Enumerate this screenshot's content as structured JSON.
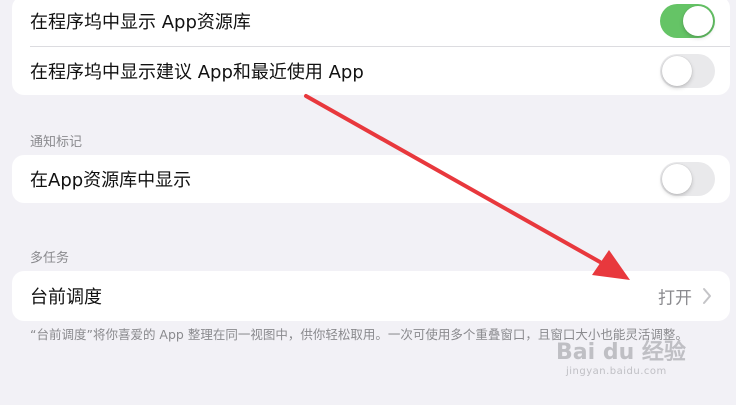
{
  "dock_card": {
    "rows": [
      {
        "label": "在程序坞中显示 App资源库",
        "toggle": true
      },
      {
        "label": "在程序坞中显示建议 App和最近使用 App",
        "toggle": false
      }
    ]
  },
  "badges_section": {
    "header": "通知标记",
    "row": {
      "label": "在App资源库中显示",
      "toggle": false
    }
  },
  "multitask_section": {
    "header": "多任务",
    "row": {
      "label": "台前调度",
      "value": "打开"
    },
    "footnote": "“台前调度”将你喜爱的 App 整理在同一视图中，供你轻松取用。一次可使用多个重叠窗口，且窗口大小也能灵活调整。"
  },
  "watermark": {
    "logo": "Bai du 经验",
    "url": "jingyan.baidu.com"
  },
  "colors": {
    "toggle_on": "#65c466",
    "toggle_off": "#e9e9eb",
    "arrow": "#e8383d",
    "background": "#f2f1f6"
  }
}
